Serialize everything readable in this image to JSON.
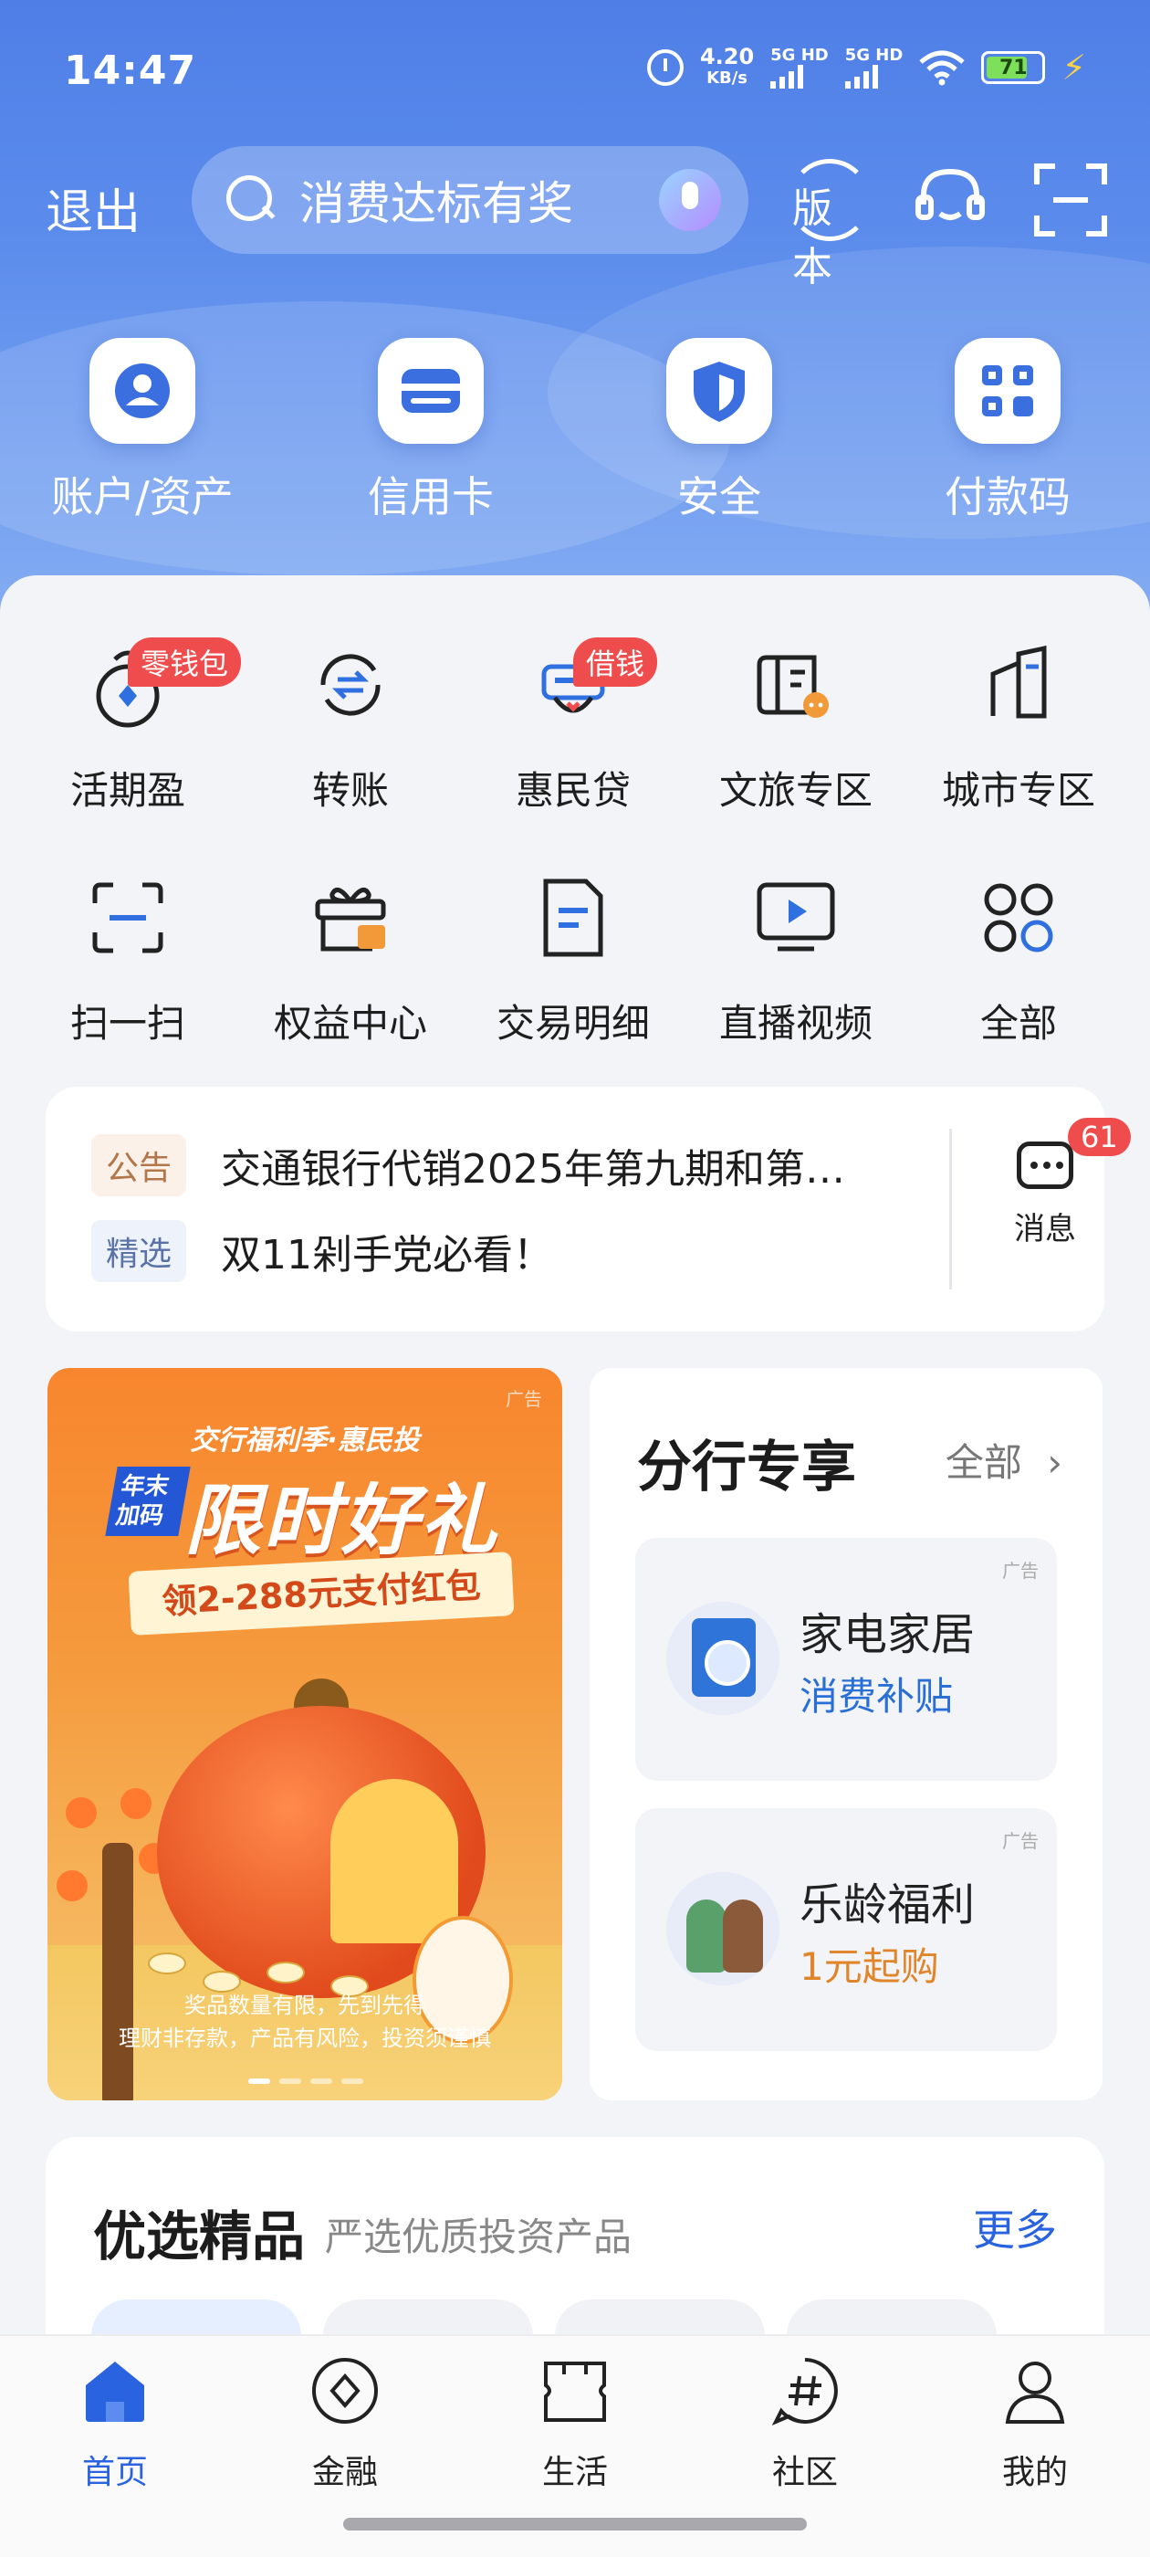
{
  "status_bar": {
    "time": "14:47",
    "speed_value": "4.20",
    "speed_unit": "KB/s",
    "sim1": "5G HD",
    "sim2": "5G HD",
    "battery": "71"
  },
  "top_bar": {
    "exit_label": "退出",
    "search_placeholder": "消费达标有奖",
    "version_label": "版本"
  },
  "quick_actions": [
    {
      "label": "账户/资产",
      "icon": "account-icon"
    },
    {
      "label": "信用卡",
      "icon": "credit-card-icon"
    },
    {
      "label": "安全",
      "icon": "shield-icon"
    },
    {
      "label": "付款码",
      "icon": "qr-code-icon"
    }
  ],
  "services": [
    {
      "label": "活期盈",
      "icon": "money-bag-icon",
      "badge": "零钱包"
    },
    {
      "label": "转账",
      "icon": "transfer-icon"
    },
    {
      "label": "惠民贷",
      "icon": "loan-icon",
      "badge": "借钱"
    },
    {
      "label": "文旅专区",
      "icon": "travel-icon"
    },
    {
      "label": "城市专区",
      "icon": "city-icon"
    },
    {
      "label": "扫一扫",
      "icon": "scan-icon"
    },
    {
      "label": "权益中心",
      "icon": "gift-icon"
    },
    {
      "label": "交易明细",
      "icon": "document-icon"
    },
    {
      "label": "直播视频",
      "icon": "video-icon"
    },
    {
      "label": "全部",
      "icon": "all-apps-icon"
    }
  ],
  "notices": [
    {
      "tag": "公告",
      "text": "交通银行代销2025年第九期和第…"
    },
    {
      "tag": "精选",
      "text": "双11剁手党必看！"
    }
  ],
  "messages": {
    "label": "消息",
    "count": "61"
  },
  "promo": {
    "ad_tag": "广告",
    "headline_small": "交行福利季·惠民投",
    "badge_text": "年末加码",
    "headline": "限时好礼",
    "offer": "领2-288元支付红包",
    "footer_line1": "奖品数量有限，先到先得",
    "footer_line2": "理财非存款，产品有风险，投资须谨慎",
    "slide_count": 4,
    "active_slide": 1
  },
  "branch": {
    "title": "分行专享",
    "all_label": "全部",
    "cards": [
      {
        "ad_tag": "广告",
        "title": "家电家居",
        "subtitle": "消费补贴",
        "subtitle_color": "#2a6fd6",
        "icon": "washing-machine-icon"
      },
      {
        "ad_tag": "广告",
        "title": "乐龄福利",
        "subtitle": "1元起购",
        "subtitle_color": "#e0852a",
        "icon": "elderly-couple-icon"
      }
    ]
  },
  "picks": {
    "title": "优选精品",
    "subtitle": "严选优质投资产品",
    "more_label": "更多"
  },
  "tab_bar": [
    {
      "label": "首页",
      "icon": "home-icon",
      "active": true
    },
    {
      "label": "金融",
      "icon": "finance-icon",
      "active": false
    },
    {
      "label": "生活",
      "icon": "life-icon",
      "active": false
    },
    {
      "label": "社区",
      "icon": "community-icon",
      "active": false
    },
    {
      "label": "我的",
      "icon": "profile-icon",
      "active": false
    }
  ],
  "colors": {
    "brand_blue": "#2a63e0",
    "badge_red": "#ef4d4d",
    "header_blue": "#4f7fe6"
  }
}
